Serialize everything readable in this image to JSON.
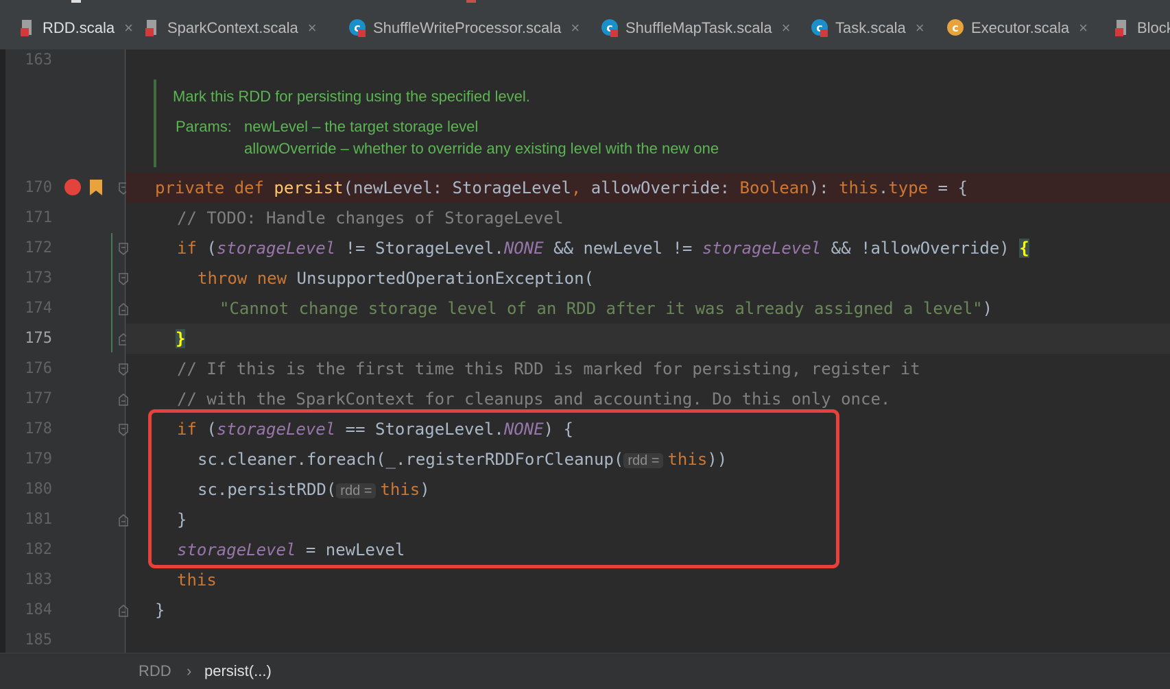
{
  "tabs": [
    {
      "label": "RDD.scala",
      "icon": "scala-file-icon",
      "active": true
    },
    {
      "label": "SparkContext.scala",
      "icon": "scala-file-icon"
    },
    {
      "label": "ShuffleWriteProcessor.scala",
      "icon": "scala-class-icon"
    },
    {
      "label": "ShuffleMapTask.scala",
      "icon": "scala-class-icon"
    },
    {
      "label": "Task.scala",
      "icon": "scala-class-icon"
    },
    {
      "label": "Executor.scala",
      "icon": "scala-class-icon"
    },
    {
      "label": "Block",
      "icon": "scala-file-icon"
    }
  ],
  "close_glyph": "×",
  "line_numbers": [
    "163",
    "170",
    "171",
    "172",
    "173",
    "174",
    "175",
    "176",
    "177",
    "178",
    "179",
    "180",
    "181",
    "182",
    "183",
    "184",
    "185"
  ],
  "current_line": "175",
  "doc": {
    "summary": "Mark this RDD for persisting using the specified level.",
    "params_label": "Params:",
    "param1": "newLevel – the target storage level",
    "param2": "allowOverride – whether to override any existing level with the new one"
  },
  "code": {
    "l170": {
      "t1": "private def ",
      "t2": "persist",
      "t3": "(newLevel: StorageLevel",
      "t4": ", ",
      "t5": "allowOverride: ",
      "t6": "Boolean",
      "t7": "): ",
      "t8": "this",
      "t9": ".",
      "t10": "type",
      "t11": " = {"
    },
    "l171": {
      "t1": "// TODO: Handle changes of StorageLevel"
    },
    "l172": {
      "t1": "if ",
      "t2": "(",
      "t3": "storageLevel",
      "t4": " != StorageLevel.",
      "t5": "NONE",
      "t6": " && newLevel != ",
      "t7": "storageLevel",
      "t8": " && !allowOverride) ",
      "t9": "{"
    },
    "l173": {
      "t1": "throw new ",
      "t2": "UnsupportedOperationException("
    },
    "l174": {
      "t1": "\"Cannot change storage level of an RDD after it was already assigned a level\"",
      "t2": ")"
    },
    "l175": {
      "t1": "}"
    },
    "l176": {
      "t1": "// If this is the first time this RDD is marked for persisting, register it"
    },
    "l177": {
      "t1": "// with the SparkContext for cleanups and accounting. Do this only once."
    },
    "l178": {
      "t1": "if ",
      "t2": "(",
      "t3": "storageLevel",
      "t4": " == StorageLevel.",
      "t5": "NONE",
      "t6": ") {"
    },
    "l179": {
      "t1": "sc.cleaner.foreach(_.registerRDDForCleanup(",
      "hint": "rdd =",
      "t2": "this",
      "t3": "))"
    },
    "l180": {
      "t1": "sc.persistRDD(",
      "hint": "rdd =",
      "t2": "this",
      "t3": ")"
    },
    "l181": {
      "t1": "}"
    },
    "l182": {
      "t1": "storageLevel",
      "t2": " = newLevel"
    },
    "l183": {
      "t1": "this"
    },
    "l184": {
      "t1": "}"
    }
  },
  "breadcrumb": {
    "items": [
      "RDD",
      "persist(...)"
    ],
    "separator": "›"
  },
  "colors": {
    "background": "#2b2b2b",
    "keyword": "#cc7832",
    "function": "#ffc66d",
    "comment": "#808080",
    "string": "#6a8759",
    "field": "#9876aa",
    "doc_comment": "#5ab552",
    "highlight_box": "#e8413c",
    "breakpoint": "#e2443b"
  }
}
